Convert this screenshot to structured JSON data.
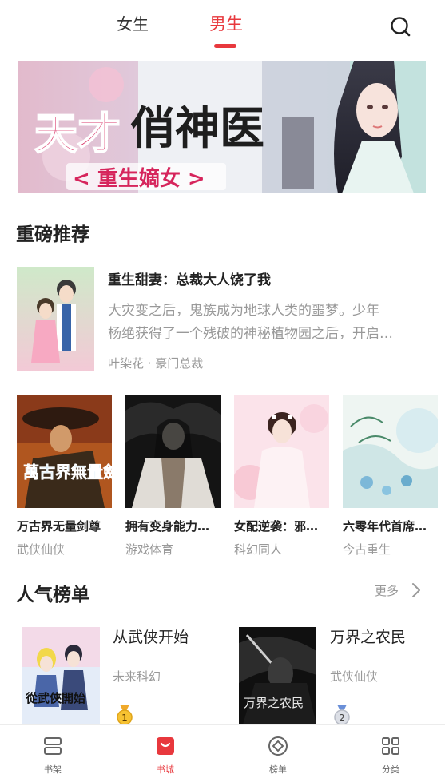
{
  "top_tabs": {
    "female": "女生",
    "male": "男生",
    "active": "男生"
  },
  "banner": {
    "title": "天才俏神医",
    "subtitle": "<重生嫡女>"
  },
  "featured": {
    "section_title": "重磅推荐",
    "book": {
      "title": "重生甜妻：总裁大人饶了我",
      "desc_line1": "大灾变之后，鬼族成为地球人类的噩梦。少年",
      "desc_line2": "杨绝获得了一个残破的神秘植物园之后，开启…",
      "meta": "叶染花 · 豪门总裁"
    },
    "grid": [
      {
        "title": "万古界无量剑尊",
        "category": "武侠仙侠",
        "cover_text": "萬古界無量劍尊"
      },
      {
        "title": "拥有变身能力…",
        "category": "游戏体育"
      },
      {
        "title": "女配逆袭：邪…",
        "category": "科幻同人"
      },
      {
        "title": "六零年代首席…",
        "category": "今古重生"
      }
    ]
  },
  "popular": {
    "section_title": "人气榜单",
    "more_label": "更多",
    "items": [
      {
        "title": "从武侠开始",
        "category": "未来科幻",
        "rank": "1",
        "cover_text": "從武俠開始"
      },
      {
        "title": "万界之农民",
        "category": "武侠仙侠",
        "rank": "2",
        "cover_text": "万界之农民"
      }
    ]
  },
  "bottom_nav": [
    {
      "label": "书架",
      "icon": "bookshelf-icon"
    },
    {
      "label": "书城",
      "icon": "bookstore-bag-icon",
      "active": true
    },
    {
      "label": "榜单",
      "icon": "ranking-diamond-icon"
    },
    {
      "label": "分类",
      "icon": "category-grid-icon"
    }
  ],
  "colors": {
    "accent": "#e8383d",
    "text": "#222222",
    "muted": "#999999"
  }
}
